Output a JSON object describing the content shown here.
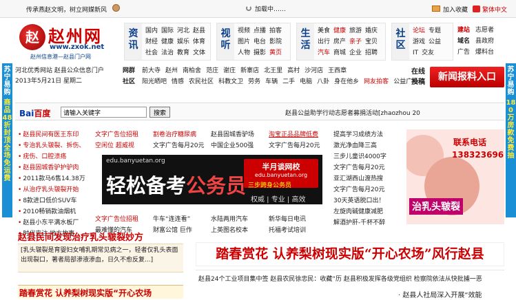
{
  "topbar": {
    "slogan": "传承燕赵文明，树立网媒新风",
    "loading": "加载中……",
    "bookmark": "加入收藏",
    "traditional": "繁体中文"
  },
  "side_left": {
    "text_a": "苏宁易购",
    "text_b": "商品48折封顶全场免运费"
  },
  "side_right": {
    "text_a": "苏宁易购",
    "text_b": "180万房款免费抽"
  },
  "logo": {
    "mark": "赵",
    "title": "赵州网",
    "url": "www.zxok.net",
    "sub": "赵州信息港—赵县门户网"
  },
  "date": {
    "line1": "河北优秀网站 赵县公众信息门户",
    "line2": "2013年5月21日 星期二"
  },
  "nav": [
    {
      "cat": "资讯",
      "rows": [
        [
          "国内",
          "国际",
          "河北",
          "赵县"
        ],
        [
          "财经",
          "健康",
          "娱乐",
          "体育"
        ],
        [
          "社会",
          "法治",
          "教育",
          "文体"
        ]
      ]
    },
    {
      "cat": "视听",
      "rows": [
        [
          "视频",
          "点播",
          "拍客"
        ],
        [
          "图片",
          "电台",
          "影院"
        ],
        [
          "人物",
          "摄影",
          "黄页"
        ]
      ]
    },
    {
      "cat": "生活",
      "rows": [
        [
          "美食",
          "健康",
          "旅游",
          "婚庆"
        ],
        [
          "出行",
          "房产",
          "亲子",
          "宝贝"
        ],
        [
          "汽车",
          "商城",
          "企业",
          "招聘"
        ]
      ]
    },
    {
      "cat": "社区",
      "rows": [
        [
          "论坛",
          "专题"
        ],
        [
          "游戏",
          "公益"
        ],
        [
          "IT",
          "交友"
        ]
      ]
    },
    {
      "cat": "",
      "rows": [
        [
          "建站",
          "志愿者"
        ],
        [
          "域名",
          "县政府"
        ],
        [
          "广告",
          "爆料台"
        ]
      ]
    }
  ],
  "nav2": {
    "row1_head": "网群",
    "row1": [
      "前大寺",
      "赵州",
      "南柏舍",
      "范庄",
      "谢庄",
      "新寨店",
      "北王里",
      "高村",
      "沙河店",
      "王西章"
    ],
    "row2_head": "社区",
    "row2": [
      "阳光晒吧",
      "情感",
      "农民社区",
      "科教文卫",
      "劳务",
      "车辆",
      "二手",
      "电脑",
      "八卦",
      "身在他乡",
      "网友拍客",
      "公益广场"
    ],
    "side1": "在线",
    "side2": "投稿"
  },
  "report_btn": "新闻报料入口",
  "search": {
    "baidu_a": "Bai",
    "baidu_b": "百度",
    "placeholder": "请输入关键字",
    "button": "搜索",
    "marquee": "赵县公益助学行动志愿者募捐活动[zhaozhou 20"
  },
  "left_list": [
    "赵县民间有医王东印",
    "专治乳头皲裂、拆伤、",
    "疣伤、口腔溃疡",
    "赵县固城香驴护驴肉",
    "2011款马6售14.38万",
    "从治疗乳头皲裂开始",
    "8款进口低价SUV车",
    "2010畅销款油烟机",
    "赵县小东平满水板厂",
    "时代夹注 地方故事"
  ],
  "mid_list_a": [
    "文字广告位招租",
    "空闲位 超威视"
  ],
  "mid_list_b": [
    "割卷治疗糖尿病",
    "文字广告每月20元"
  ],
  "mid_list_c": [
    "赵县固城香驴场",
    "中国企业500强"
  ],
  "mid_list_d": [
    "淘宝正品品牌低费",
    "文字广告每月20元"
  ],
  "right_list": [
    "提高学习成绩方法",
    "激光净血降三高",
    "三步儿童识4000字",
    "文字广告每月20元",
    "亚汇湖西山渡热搜",
    "文字广告每月20元",
    "30天英语脱口出！",
    "左旋肉碱健康减肥",
    "解酒护肝-千杯不醉"
  ],
  "bigad": {
    "url": "edu.banyuetan.org",
    "headline_a": "轻松备考",
    "headline_b": "公务员",
    "brand": "半月谈网校",
    "brand_url": "edu.banyuetan.org",
    "slogan": "三步跨身公务员",
    "tags": "权威 | 专业 | 高效"
  },
  "under_ad_left": [
    "文字广告位招租",
    "最难懂的汽车"
  ],
  "under_ad_mid": [
    "牛车“连连看”",
    "财富公馆 巨作"
  ],
  "under_ad_mid2": [
    "水陆两用汽车",
    "上英图名校本"
  ],
  "under_ad_right": [
    "新华每日电讯",
    "托福考试培训"
  ],
  "rightad": {
    "t1": "联系电话",
    "t2": "13832369694",
    "t3": "治乳头皲裂"
  },
  "bottom": {
    "left_title": "赵县民间发现治疗乳头皲裂妙方",
    "left_desc": "[乳头皲裂是育婴妇女哺乳期常见病之一，轻者仅乳头表面出现裂口，著者局部渗液渗血，日久不愈反复...]",
    "left_more": "踏春赏花 认养梨树现实版“开心农场",
    "main_title": "踏春赏花 认养梨树现实版“开心农场”风行赵县",
    "main_line": "赵县24个工业项目集中签 赵县农民徐忠民：收藏“历 赵县积极发挥各级党组织 检察院依法从快批捕一恶",
    "main_sub": "· 赵县人社局深入开展“效能"
  }
}
